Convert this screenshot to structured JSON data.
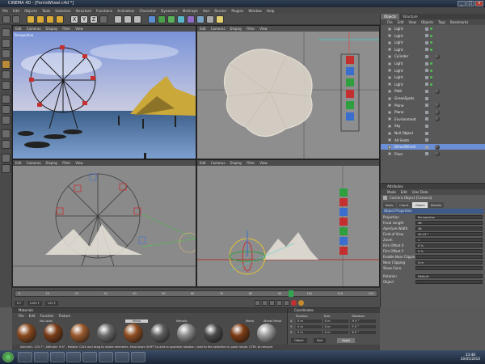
{
  "window": {
    "title": "CINEMA 4D - [FerrisWheel.c4d *]",
    "min": "_",
    "max": "□",
    "close": "x"
  },
  "menu": [
    "File",
    "Edit",
    "Objects",
    "Tools",
    "Selection",
    "Structure",
    "Functions",
    "Animation",
    "Character",
    "Dynamics",
    "MoGraph",
    "Hair",
    "Render",
    "Plugins",
    "Window",
    "Help"
  ],
  "toolbar": {
    "mode_glyphs": [
      "X",
      "Y",
      "Z"
    ],
    "icon_names": [
      "undo-icon",
      "redo-icon",
      "live-select-icon",
      "move-icon",
      "scale-icon",
      "rotate-icon",
      "x-axis-icon",
      "y-axis-icon",
      "z-axis-icon",
      "world-coords-icon",
      "render-view-icon",
      "render-picture-icon",
      "render-settings-icon",
      "cube-icon",
      "spline-icon",
      "nurbs-icon",
      "array-icon",
      "deformer-icon",
      "scene-icon",
      "camera-icon",
      "light-icon"
    ]
  },
  "viewport_menu": [
    "Edit",
    "Cameras",
    "Display",
    "Filter",
    "View"
  ],
  "viewports": [
    {
      "id": "perspective",
      "label": "Perspective"
    },
    {
      "id": "top",
      "label": ""
    },
    {
      "id": "right",
      "label": ""
    },
    {
      "id": "front",
      "label": ""
    }
  ],
  "object_manager": {
    "tabs": [
      "Objects",
      "Structure"
    ],
    "menu": [
      "File",
      "Edit",
      "View",
      "Objects",
      "Tags",
      "Bookmarks"
    ],
    "objects": [
      "Light",
      "Light",
      "Light",
      "Light",
      "Cylinder",
      "Light",
      "Light",
      "Light",
      "Light",
      "Path",
      "GreenSpots",
      "Plane",
      "Plane",
      "Environment",
      "Sky",
      "Null Object",
      "All Seats",
      "WheelWheel",
      "Floor"
    ]
  },
  "attributes": {
    "title": "Attributes",
    "menu": [
      "Mode",
      "Edit",
      "User Data"
    ],
    "object_name": "Camera Object [Camera]",
    "tabs": [
      "Basic",
      "Coord.",
      "Object",
      "Details"
    ],
    "section": "Object Properties",
    "rows": [
      {
        "label": "Projection",
        "value": "Perspective"
      },
      {
        "label": "Focal Length",
        "value": "36"
      },
      {
        "label": "Aperture Width",
        "value": "36"
      },
      {
        "label": "Field of View",
        "value": "53.13 °"
      },
      {
        "label": "Zoom",
        "value": "1"
      },
      {
        "label": "Film Offset X",
        "value": "0 %"
      },
      {
        "label": "Film Offset Y",
        "value": "0 %"
      },
      {
        "label": "Enable Near Clipping",
        "value": ""
      },
      {
        "label": "Near Clipping",
        "value": "0 m"
      },
      {
        "label": "Show Cone",
        "value": ""
      }
    ],
    "rotation_label": "Rotation",
    "rotation_value": "Default",
    "object_label": "Object"
  },
  "timeline": {
    "current": "125 F",
    "marks": [
      "0",
      "10",
      "20",
      "30",
      "40",
      "50",
      "60",
      "70",
      "80",
      "90",
      "100",
      "110",
      "120"
    ],
    "start": "0 F",
    "end": "1200 F"
  },
  "materials": {
    "title": "Materials",
    "menu": [
      "File",
      "Edit",
      "Function",
      "Texture"
    ],
    "labels": [
      "",
      "No Label",
      "",
      "",
      "",
      "Metal",
      "",
      "Metallic",
      "",
      "",
      "Metal",
      "Wheel Metal"
    ],
    "colors": [
      "#8a4a1f",
      "#7a3d18",
      "#9b5a2e",
      "#6a6a6a",
      "#8f4e23",
      "#5f5f5f",
      "#8b8b8b",
      "#4a4a4a",
      "#7d3c14",
      "#9a9a9a"
    ]
  },
  "coordinates": {
    "title": "Coordinates",
    "headers": [
      "Position",
      "Size",
      "Rotation"
    ],
    "rows": [
      {
        "axis": "X",
        "pos": "0 m",
        "size": "0 m",
        "rot": "H 0 °"
      },
      {
        "axis": "Y",
        "pos": "0 m",
        "size": "0 m",
        "rot": "P 0 °"
      },
      {
        "axis": "Z",
        "pos": "0 m",
        "size": "0 m",
        "rot": "B 0 °"
      }
    ],
    "mode_a": "Object",
    "mode_b": "Size",
    "apply": "Apply"
  },
  "status": "Azimuth: 125.7°, Altitude: 9.6° - Rotate: Click and drag to rotate elements. Hold down SHIFT to add to quantize rotation / add to the selection in point mode. CTRL to remove.",
  "taskbar": {
    "time": "23:48",
    "date": "20/05/2010"
  },
  "colors": {
    "accent": "#f0c020",
    "select": "#6b8fd6"
  }
}
